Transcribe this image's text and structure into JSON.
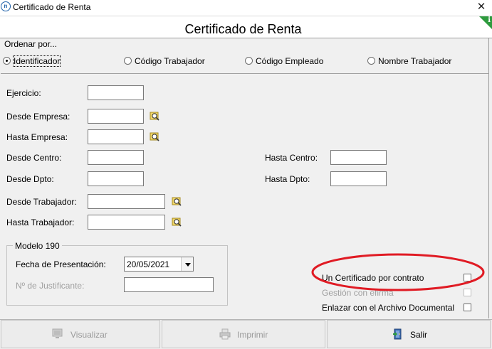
{
  "window": {
    "title": "Certificado de Renta",
    "icon": "app-logo-icon",
    "close_glyph": "✕"
  },
  "header": {
    "title": "Certificado de Renta",
    "info_glyph": "i",
    "info_color": "#2e9b3e"
  },
  "order": {
    "label": "Ordenar por...",
    "options": [
      {
        "label": "Identificador",
        "selected": true
      },
      {
        "label": "Código Trabajador",
        "selected": false
      },
      {
        "label": "Código Empleado",
        "selected": false
      },
      {
        "label": "Nombre Trabajador",
        "selected": false
      }
    ]
  },
  "fields": {
    "ejercicio": {
      "label": "Ejercicio:",
      "value": ""
    },
    "desde_empresa": {
      "label": "Desde Empresa:",
      "value": ""
    },
    "hasta_empresa": {
      "label": "Hasta Empresa:",
      "value": ""
    },
    "desde_centro": {
      "label": "Desde Centro:",
      "value": ""
    },
    "hasta_centro": {
      "label": "Hasta Centro:",
      "value": ""
    },
    "desde_dpto": {
      "label": "Desde Dpto:",
      "value": ""
    },
    "hasta_dpto": {
      "label": "Hasta Dpto:",
      "value": ""
    },
    "desde_trabajador": {
      "label": "Desde Trabajador:",
      "value": ""
    },
    "hasta_trabajador": {
      "label": "Hasta Trabajador:",
      "value": ""
    }
  },
  "modelo190": {
    "legend": "Modelo 190",
    "fecha_label": "Fecha de Presentación:",
    "fecha_value": "20/05/2021",
    "justificante_label": "Nº de Justificante:",
    "justificante_value": ""
  },
  "options": {
    "un_certificado": {
      "label": "Un Certificado por contrato",
      "checked": false
    },
    "gestion_efirma": {
      "label": "Gestión con efirma",
      "checked": false,
      "disabled": true
    },
    "enlazar_archivo": {
      "label": "Enlazar con el Archivo Documental",
      "checked": false
    }
  },
  "annotation": {
    "color": "#e01b24",
    "shape": "ellipse"
  },
  "buttons": {
    "visualizar": {
      "label": "Visualizar",
      "icon": "monitor-icon",
      "disabled": true
    },
    "imprimir": {
      "label": "Imprimir",
      "icon": "printer-icon",
      "disabled": true
    },
    "salir": {
      "label": "Salir",
      "icon": "exit-door-icon",
      "disabled": false
    }
  }
}
